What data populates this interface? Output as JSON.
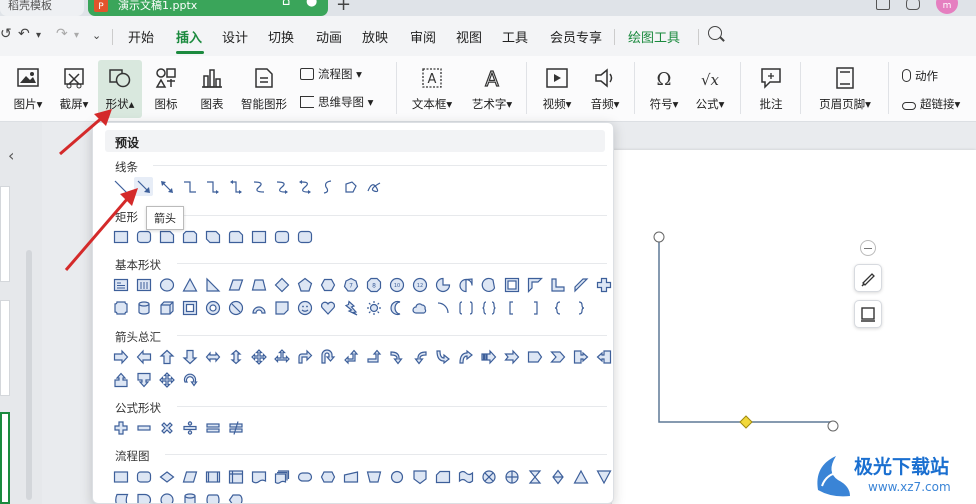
{
  "titlebar": {
    "inactive_tab": "稻壳模板",
    "active_tab": "演示文稿1.pptx",
    "active_tab_icon": "P",
    "new_tab": "+",
    "avatar_text": "m"
  },
  "menu": {
    "items": [
      "开始",
      "插入",
      "设计",
      "切换",
      "动画",
      "放映",
      "审阅",
      "视图",
      "工具",
      "会员专享",
      "绘图工具"
    ],
    "active": "插入",
    "accent": "#1b8a3e"
  },
  "ribbon": {
    "picture": "图片",
    "screenshot": "截屏",
    "shape": "形状",
    "icon": "图标",
    "chart": "图表",
    "smart": "智能图形",
    "flowchart": "流程图",
    "mindmap": "思维导图",
    "textbox": "文本框",
    "wordart": "艺术字",
    "video": "视频",
    "audio": "音频",
    "symbol": "符号",
    "formula": "公式",
    "comment": "批注",
    "header_footer": "页眉页脚",
    "action": "动作",
    "hyperlink": "超链接"
  },
  "dropdown": {
    "preset": "预设",
    "categories": {
      "lines": "线条",
      "rect": "矩形",
      "basic": "基本形状",
      "arrows": "箭头总汇",
      "formula": "公式形状",
      "flowchart": "流程图"
    },
    "tooltip": "箭头"
  },
  "watermark": {
    "text": "极光下载站",
    "url": "www.xz7.com"
  },
  "colors": {
    "shape_stroke": "#3d5f9a",
    "shape_fill": "#dde6f4",
    "annotation_arrow": "#d42a2a",
    "tab_green": "#3aa55a"
  }
}
